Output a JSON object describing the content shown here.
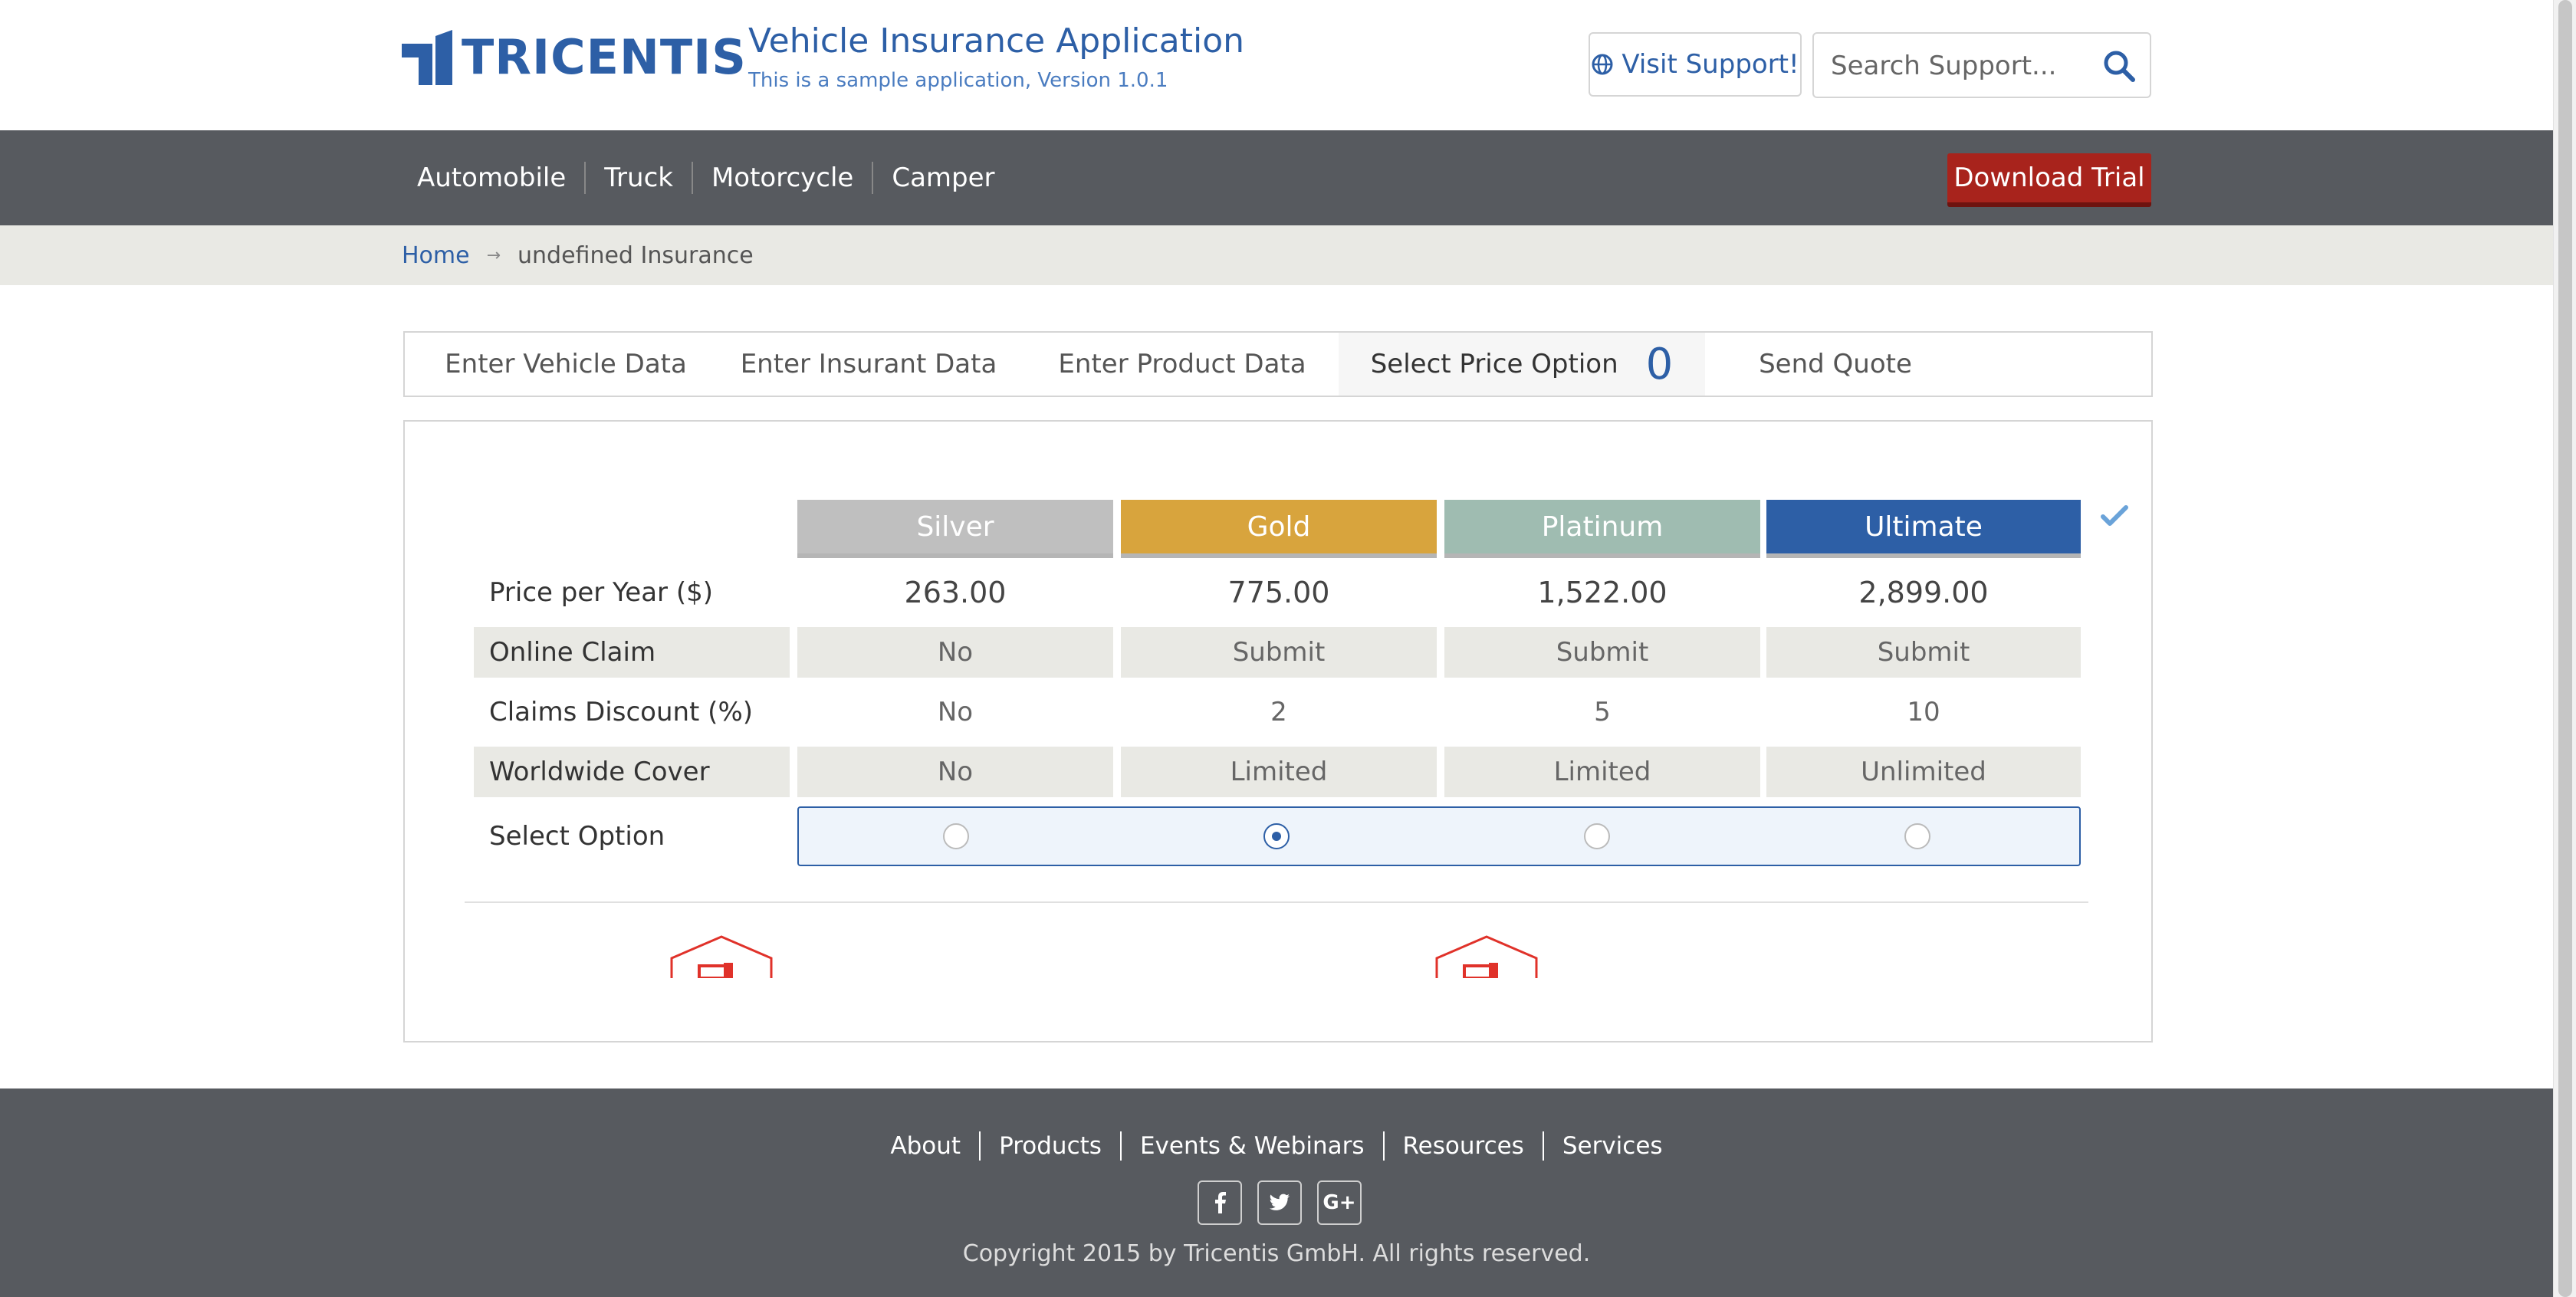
{
  "header": {
    "brand": "TRICENTIS",
    "app_title": "Vehicle Insurance Application",
    "app_subtitle": "This is a sample application, Version 1.0.1",
    "visit_support_label": "Visit Support!",
    "search_placeholder": "Search Support..."
  },
  "nav": {
    "items": [
      {
        "label": "Automobile"
      },
      {
        "label": "Truck"
      },
      {
        "label": "Motorcycle"
      },
      {
        "label": "Camper"
      }
    ],
    "download_trial_label": "Download Trial"
  },
  "breadcrumb": {
    "home": "Home",
    "current": "undefined Insurance"
  },
  "wizard": {
    "tabs": [
      {
        "label": "Enter Vehicle Data"
      },
      {
        "label": "Enter Insurant Data"
      },
      {
        "label": "Enter Product Data"
      },
      {
        "label": "Select Price Option",
        "count": "0",
        "active": true
      },
      {
        "label": "Send Quote"
      }
    ]
  },
  "price_table": {
    "plans": [
      "Silver",
      "Gold",
      "Platinum",
      "Ultimate"
    ],
    "rows": [
      {
        "label": "Price per Year ($)",
        "values": [
          "263.00",
          "775.00",
          "1,522.00",
          "2,899.00"
        ]
      },
      {
        "label": "Online Claim",
        "values": [
          "No",
          "Submit",
          "Submit",
          "Submit"
        ]
      },
      {
        "label": "Claims Discount (%)",
        "values": [
          "No",
          "2",
          "5",
          "10"
        ]
      },
      {
        "label": "Worldwide Cover",
        "values": [
          "No",
          "Limited",
          "Limited",
          "Unlimited"
        ]
      }
    ],
    "select_label": "Select Option",
    "selected_plan": "Gold"
  },
  "footer": {
    "links": [
      {
        "label": "About"
      },
      {
        "label": "Products"
      },
      {
        "label": "Events & Webinars"
      },
      {
        "label": "Resources"
      },
      {
        "label": "Services"
      }
    ],
    "social": [
      {
        "icon": "facebook-icon",
        "glyph": "f"
      },
      {
        "icon": "twitter-icon",
        "glyph": "t"
      },
      {
        "icon": "google-plus-icon",
        "glyph": "G+"
      }
    ],
    "copyright": "Copyright 2015 by Tricentis GmbH. All rights reserved."
  },
  "colors": {
    "brand_blue": "#2d5fa6",
    "nav_gray": "#575a5f",
    "trial_red": "#a8231c",
    "silver": "#bfbfbf",
    "gold": "#d8a43d",
    "platinum": "#9fbcb1",
    "ultimate": "#2d5fa6"
  }
}
